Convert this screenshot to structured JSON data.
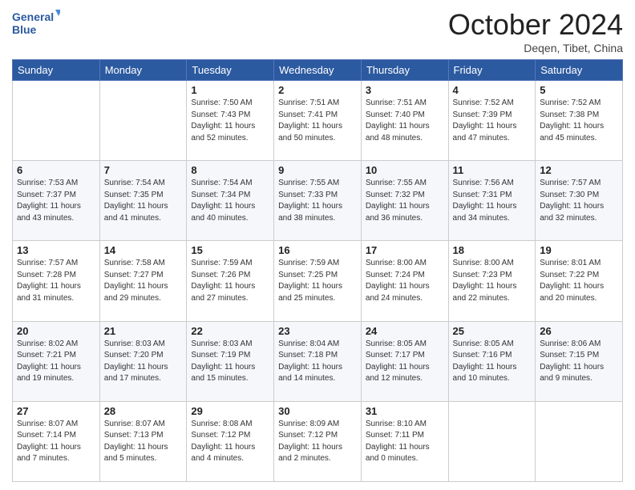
{
  "header": {
    "logo_line1": "General",
    "logo_line2": "Blue",
    "month": "October 2024",
    "location": "Deqen, Tibet, China"
  },
  "days_of_week": [
    "Sunday",
    "Monday",
    "Tuesday",
    "Wednesday",
    "Thursday",
    "Friday",
    "Saturday"
  ],
  "weeks": [
    [
      {
        "num": "",
        "info": ""
      },
      {
        "num": "",
        "info": ""
      },
      {
        "num": "1",
        "info": "Sunrise: 7:50 AM\nSunset: 7:43 PM\nDaylight: 11 hours and 52 minutes."
      },
      {
        "num": "2",
        "info": "Sunrise: 7:51 AM\nSunset: 7:41 PM\nDaylight: 11 hours and 50 minutes."
      },
      {
        "num": "3",
        "info": "Sunrise: 7:51 AM\nSunset: 7:40 PM\nDaylight: 11 hours and 48 minutes."
      },
      {
        "num": "4",
        "info": "Sunrise: 7:52 AM\nSunset: 7:39 PM\nDaylight: 11 hours and 47 minutes."
      },
      {
        "num": "5",
        "info": "Sunrise: 7:52 AM\nSunset: 7:38 PM\nDaylight: 11 hours and 45 minutes."
      }
    ],
    [
      {
        "num": "6",
        "info": "Sunrise: 7:53 AM\nSunset: 7:37 PM\nDaylight: 11 hours and 43 minutes."
      },
      {
        "num": "7",
        "info": "Sunrise: 7:54 AM\nSunset: 7:35 PM\nDaylight: 11 hours and 41 minutes."
      },
      {
        "num": "8",
        "info": "Sunrise: 7:54 AM\nSunset: 7:34 PM\nDaylight: 11 hours and 40 minutes."
      },
      {
        "num": "9",
        "info": "Sunrise: 7:55 AM\nSunset: 7:33 PM\nDaylight: 11 hours and 38 minutes."
      },
      {
        "num": "10",
        "info": "Sunrise: 7:55 AM\nSunset: 7:32 PM\nDaylight: 11 hours and 36 minutes."
      },
      {
        "num": "11",
        "info": "Sunrise: 7:56 AM\nSunset: 7:31 PM\nDaylight: 11 hours and 34 minutes."
      },
      {
        "num": "12",
        "info": "Sunrise: 7:57 AM\nSunset: 7:30 PM\nDaylight: 11 hours and 32 minutes."
      }
    ],
    [
      {
        "num": "13",
        "info": "Sunrise: 7:57 AM\nSunset: 7:28 PM\nDaylight: 11 hours and 31 minutes."
      },
      {
        "num": "14",
        "info": "Sunrise: 7:58 AM\nSunset: 7:27 PM\nDaylight: 11 hours and 29 minutes."
      },
      {
        "num": "15",
        "info": "Sunrise: 7:59 AM\nSunset: 7:26 PM\nDaylight: 11 hours and 27 minutes."
      },
      {
        "num": "16",
        "info": "Sunrise: 7:59 AM\nSunset: 7:25 PM\nDaylight: 11 hours and 25 minutes."
      },
      {
        "num": "17",
        "info": "Sunrise: 8:00 AM\nSunset: 7:24 PM\nDaylight: 11 hours and 24 minutes."
      },
      {
        "num": "18",
        "info": "Sunrise: 8:00 AM\nSunset: 7:23 PM\nDaylight: 11 hours and 22 minutes."
      },
      {
        "num": "19",
        "info": "Sunrise: 8:01 AM\nSunset: 7:22 PM\nDaylight: 11 hours and 20 minutes."
      }
    ],
    [
      {
        "num": "20",
        "info": "Sunrise: 8:02 AM\nSunset: 7:21 PM\nDaylight: 11 hours and 19 minutes."
      },
      {
        "num": "21",
        "info": "Sunrise: 8:03 AM\nSunset: 7:20 PM\nDaylight: 11 hours and 17 minutes."
      },
      {
        "num": "22",
        "info": "Sunrise: 8:03 AM\nSunset: 7:19 PM\nDaylight: 11 hours and 15 minutes."
      },
      {
        "num": "23",
        "info": "Sunrise: 8:04 AM\nSunset: 7:18 PM\nDaylight: 11 hours and 14 minutes."
      },
      {
        "num": "24",
        "info": "Sunrise: 8:05 AM\nSunset: 7:17 PM\nDaylight: 11 hours and 12 minutes."
      },
      {
        "num": "25",
        "info": "Sunrise: 8:05 AM\nSunset: 7:16 PM\nDaylight: 11 hours and 10 minutes."
      },
      {
        "num": "26",
        "info": "Sunrise: 8:06 AM\nSunset: 7:15 PM\nDaylight: 11 hours and 9 minutes."
      }
    ],
    [
      {
        "num": "27",
        "info": "Sunrise: 8:07 AM\nSunset: 7:14 PM\nDaylight: 11 hours and 7 minutes."
      },
      {
        "num": "28",
        "info": "Sunrise: 8:07 AM\nSunset: 7:13 PM\nDaylight: 11 hours and 5 minutes."
      },
      {
        "num": "29",
        "info": "Sunrise: 8:08 AM\nSunset: 7:12 PM\nDaylight: 11 hours and 4 minutes."
      },
      {
        "num": "30",
        "info": "Sunrise: 8:09 AM\nSunset: 7:12 PM\nDaylight: 11 hours and 2 minutes."
      },
      {
        "num": "31",
        "info": "Sunrise: 8:10 AM\nSunset: 7:11 PM\nDaylight: 11 hours and 0 minutes."
      },
      {
        "num": "",
        "info": ""
      },
      {
        "num": "",
        "info": ""
      }
    ]
  ]
}
